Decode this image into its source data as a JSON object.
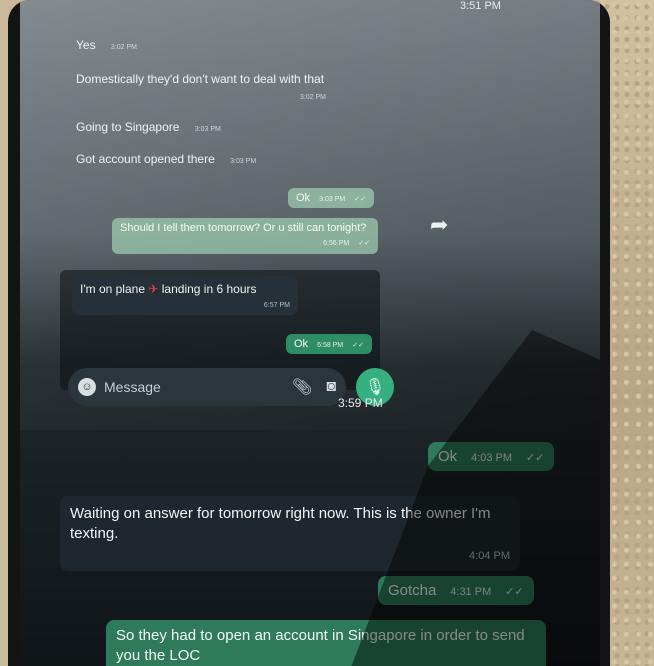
{
  "status_time_top": "3:51 PM",
  "messages_upper": [
    {
      "text": "Yes",
      "time": "3:02 PM"
    },
    {
      "text": "Domestically they'd don't want to deal with that",
      "time": "3:02 PM"
    },
    {
      "text": "Going to Singapore",
      "time": "3:03 PM"
    },
    {
      "text": "Got account opened there",
      "time": "3:03 PM"
    }
  ],
  "out_ok_1": {
    "text": "Ok",
    "time": "3:03 PM",
    "ticks": "✓✓"
  },
  "out_question": {
    "text": "Should I tell them tomorrow? Or u still can tonight?",
    "time": "6:56 PM",
    "ticks": "✓✓"
  },
  "in_plane": {
    "text": "I'm on plane",
    "emoji": "✈",
    "text2": "landing in 6 hours",
    "time": "6:57 PM"
  },
  "out_ok_2": {
    "text": "Ok",
    "time": "6:58 PM",
    "ticks": "✓✓"
  },
  "input": {
    "placeholder": "Message"
  },
  "time_mid": "3:59 PM",
  "out_ok_3": {
    "text": "Ok",
    "time": "4:03 PM",
    "ticks": "✓✓"
  },
  "in_waiting": {
    "text": "Waiting on answer for tomorrow right now.  This is the owner I'm texting.",
    "time": "4:04 PM"
  },
  "out_gotcha": {
    "text": "Gotcha",
    "time": "4:31 PM",
    "ticks": "✓✓"
  },
  "out_singapore": {
    "text": "So they had to open an account in Singapore in order to send you the LOC"
  },
  "colors": {
    "accent_green": "#2f7a5a",
    "mic_green": "#35b07e",
    "dark_bubble": "#1e272d"
  },
  "icons": [
    "emoji-icon",
    "attach-icon",
    "camera-icon",
    "mic-icon",
    "forward-icon"
  ]
}
